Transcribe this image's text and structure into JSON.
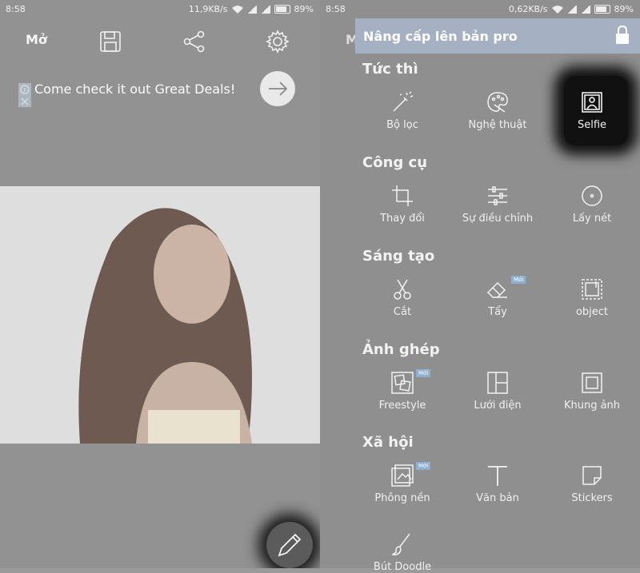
{
  "left": {
    "status": {
      "time": "8:58",
      "speed": "11,9KB/s",
      "battery": "89%"
    },
    "toolbar": {
      "open_label": "Mở"
    },
    "ad": {
      "text": "Come check it out Great Deals!"
    }
  },
  "right": {
    "status": {
      "time": "8:58",
      "speed": "0,62KB/s",
      "battery": "89%"
    },
    "peek_label": "M",
    "pro_banner": "Nâng cấp lên bản pro",
    "new_badge": "Mới",
    "sections": {
      "instant": {
        "title": "Tức thì",
        "items": [
          "Bộ lọc",
          "Nghệ thuật",
          "Selfie"
        ]
      },
      "tools": {
        "title": "Công cụ",
        "items": [
          "Thay đổi",
          "Sự điều chỉnh",
          "Lấy nét"
        ]
      },
      "creative": {
        "title": "Sáng tạo",
        "items": [
          "Cắt",
          "Tẩy",
          "object"
        ]
      },
      "collage": {
        "title": "Ảnh ghép",
        "items": [
          "Freestyle",
          "Lưới điện",
          "Khung ảnh"
        ]
      },
      "social": {
        "title": "Xã hội",
        "items": [
          "Phông nền",
          "Văn bản",
          "Stickers"
        ]
      },
      "extra": {
        "items": [
          "Bút Doodle"
        ]
      }
    }
  }
}
